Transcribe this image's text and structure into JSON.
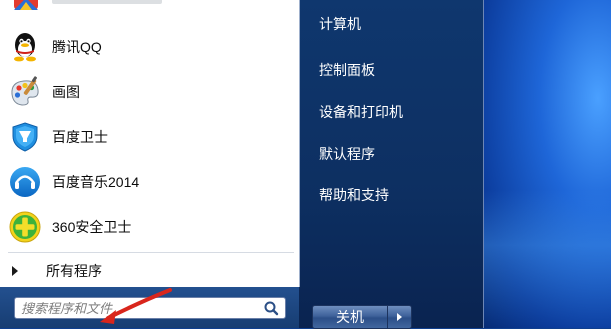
{
  "start_menu": {
    "programs": [
      {
        "label": "腾讯QQ",
        "icon": "qq-penguin-icon"
      },
      {
        "label": "画图",
        "icon": "paint-palette-icon"
      },
      {
        "label": "百度卫士",
        "icon": "baidu-guard-shield-icon"
      },
      {
        "label": "百度音乐2014",
        "icon": "baidu-music-icon"
      },
      {
        "label": "360安全卫士",
        "icon": "360-safe-guard-icon"
      }
    ],
    "all_programs_label": "所有程序",
    "search": {
      "placeholder": "搜索程序和文件"
    },
    "right_items": [
      {
        "label": "计算机"
      },
      {
        "label": "控制面板"
      },
      {
        "label": "设备和打印机"
      },
      {
        "label": "默认程序"
      },
      {
        "label": "帮助和支持"
      }
    ],
    "shutdown_label": "关机"
  },
  "colors": {
    "menu_dark_blue": "#0d2f61",
    "desktop_blue": "#1e66d8",
    "annotation_red": "#d9261c"
  }
}
